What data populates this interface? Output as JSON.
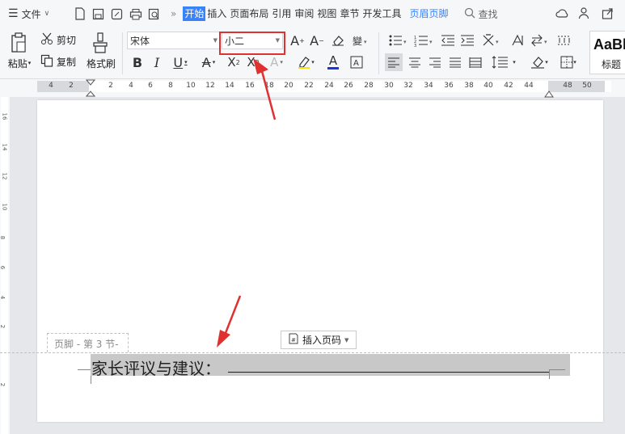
{
  "menu": {
    "file_label": "文件",
    "tabs": [
      "开始",
      "插入",
      "页面布局",
      "引用",
      "审阅",
      "视图",
      "章节",
      "开发工具"
    ],
    "active_tab": "开始",
    "special_tab": "页眉页脚",
    "search_label": "查找",
    "more": "»"
  },
  "ribbon": {
    "paste_label": "粘贴",
    "cut_label": "剪切",
    "copy_label": "复制",
    "format_painter_label": "格式刷",
    "font_name": "宋体",
    "font_size": "小二",
    "style_preview": "AaBl",
    "style_label": "标题"
  },
  "ruler": {
    "ticks": [
      "4",
      "2",
      "2",
      "4",
      "6",
      "8",
      "10",
      "12",
      "14",
      "16",
      "18",
      "20",
      "22",
      "24",
      "26",
      "28",
      "30",
      "32",
      "34",
      "36",
      "38",
      "40",
      "42",
      "44",
      "48",
      "50"
    ],
    "vticks": [
      "16",
      "14",
      "12",
      "10",
      "8",
      "6",
      "4",
      "2",
      "2"
    ]
  },
  "document": {
    "footer_tag": "页脚 - 第 3 节-",
    "insert_page_number": "插入页码",
    "footer_text": "家长评议与建议："
  },
  "colors": {
    "accent": "#3a82f7",
    "highlight": "#e03131",
    "font_color_bar": "#1a36d9",
    "arrow": "#e03131"
  }
}
